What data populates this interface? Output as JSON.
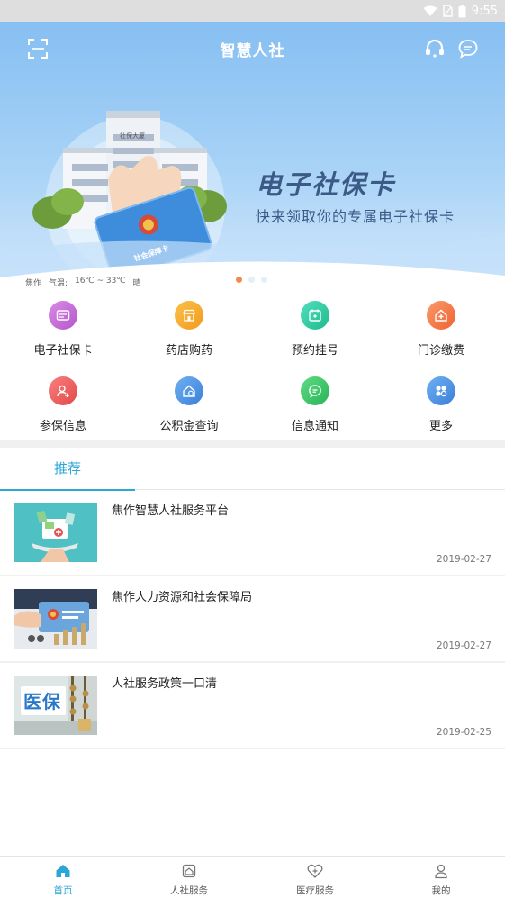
{
  "status_bar": {
    "time": "9:55"
  },
  "header": {
    "title": "智慧人社"
  },
  "banner": {
    "title": "电子社保卡",
    "subtitle": "快来领取你的专属电子社保卡",
    "building_sign": "社保大厦",
    "card_text": "社会保障卡"
  },
  "weather": {
    "city": "焦作",
    "temp_label": "气温:",
    "temp_range": "16℃ ~ 33℃",
    "condition": "晴"
  },
  "services": [
    {
      "label": "电子社保卡",
      "color": "#c56ad6",
      "icon": "id-card-icon"
    },
    {
      "label": "药店购药",
      "color": "#f4a52a",
      "icon": "pharmacy-icon"
    },
    {
      "label": "预约挂号",
      "color": "#2ec9a0",
      "icon": "appointment-icon"
    },
    {
      "label": "门诊缴费",
      "color": "#f3794a",
      "icon": "clinic-payment-icon"
    },
    {
      "label": "参保信息",
      "color": "#ef5a5a",
      "icon": "insurance-info-icon"
    },
    {
      "label": "公积金查询",
      "color": "#4f94e4",
      "icon": "fund-query-icon"
    },
    {
      "label": "信息通知",
      "color": "#3fc86a",
      "icon": "message-icon"
    },
    {
      "label": "更多",
      "color": "#4f94e4",
      "icon": "more-icon"
    }
  ],
  "tabs": [
    {
      "label": "推荐"
    }
  ],
  "news": [
    {
      "title": "焦作智慧人社服务平台",
      "date": "2019-02-27"
    },
    {
      "title": "焦作人力资源和社会保障局",
      "date": "2019-02-27"
    },
    {
      "title": "人社服务政策一口清",
      "date": "2019-02-25",
      "thumb_text": "医保"
    }
  ],
  "bottom_nav": [
    {
      "label": "首页",
      "active": true
    },
    {
      "label": "人社服务",
      "active": false
    },
    {
      "label": "医疗服务",
      "active": false
    },
    {
      "label": "我的",
      "active": false
    }
  ],
  "colors": {
    "accent": "#2aa7d6",
    "banner_text": "#3c5a86",
    "dot_active": "#f08a4b"
  }
}
